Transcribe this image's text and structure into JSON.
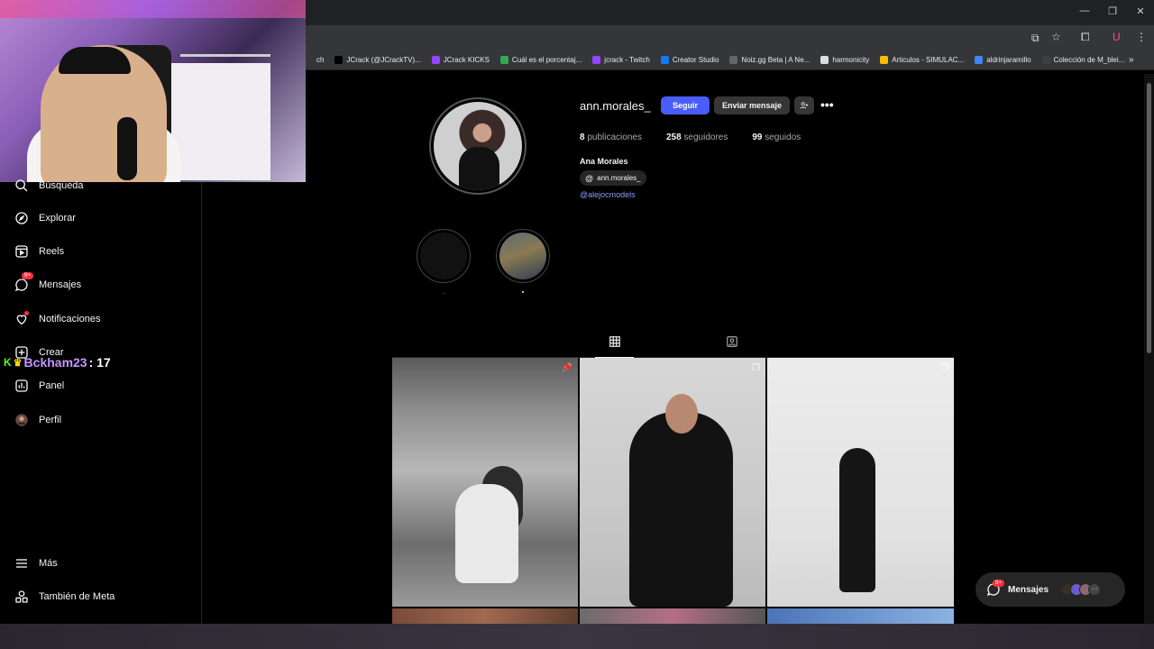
{
  "browser": {
    "bookmarks": [
      {
        "label": "ch",
        "color": "#35363a"
      },
      {
        "label": "JCrack (@JCrackTV)...",
        "color": "#000000"
      },
      {
        "label": "JCrack KICKS",
        "color": "#9146ff"
      },
      {
        "label": "Cuál es el porcentaj...",
        "color": "#34a853"
      },
      {
        "label": "jcrack - Twitch",
        "color": "#9146ff"
      },
      {
        "label": "Creator Studio",
        "color": "#1877f2"
      },
      {
        "label": "Noiz.gg Beta | A Ne...",
        "color": "#666666"
      },
      {
        "label": "harmonicity",
        "color": "#dddddd"
      },
      {
        "label": "Articulos - SIMULAC...",
        "color": "#fbbc04"
      },
      {
        "label": "aldrinjaramillo",
        "color": "#4285f4"
      },
      {
        "label": "Colección de M_blei...",
        "color": "#3c4043"
      }
    ],
    "more_bookmarks": "»"
  },
  "sidebar": {
    "items": [
      {
        "label": "Búsqueda",
        "icon": "search-icon"
      },
      {
        "label": "Explorar",
        "icon": "compass-icon"
      },
      {
        "label": "Reels",
        "icon": "reels-icon"
      },
      {
        "label": "Mensajes",
        "icon": "messenger-icon",
        "badge": "9+"
      },
      {
        "label": "Notificaciones",
        "icon": "heart-icon"
      },
      {
        "label": "Crear",
        "icon": "plus-square-icon"
      },
      {
        "label": "Panel",
        "icon": "chart-icon"
      },
      {
        "label": "Perfil",
        "icon": "avatar-icon"
      },
      {
        "label": "Más",
        "icon": "menu-icon"
      },
      {
        "label": "También de Meta",
        "icon": "meta-apps-icon"
      }
    ]
  },
  "stream_chat": {
    "user": "Bckham23",
    "message": ": 17"
  },
  "profile": {
    "username": "ann.morales_",
    "follow_label": "Seguir",
    "message_label": "Enviar mensaje",
    "more_label": "•••",
    "posts_count": "8",
    "posts_label": "publicaciones",
    "followers_count": "258",
    "followers_label": "seguidores",
    "following_count": "99",
    "following_label": "seguidos",
    "full_name": "Ana Morales",
    "threads_handle": "ann.morales_",
    "bio_link": "@alejocmodels"
  },
  "highlights": [
    {
      "label": "."
    },
    {
      "label": "▪"
    }
  ],
  "tabs": [
    {
      "name": "posts",
      "icon": "grid-icon",
      "active": true
    },
    {
      "name": "tagged",
      "icon": "tagged-icon",
      "active": false
    }
  ],
  "messages_pill": {
    "label": "Mensajes",
    "badge": "9+"
  },
  "colors": {
    "accent": "#4a5df9",
    "notification": "#ff3040",
    "link": "#8a9dff"
  }
}
